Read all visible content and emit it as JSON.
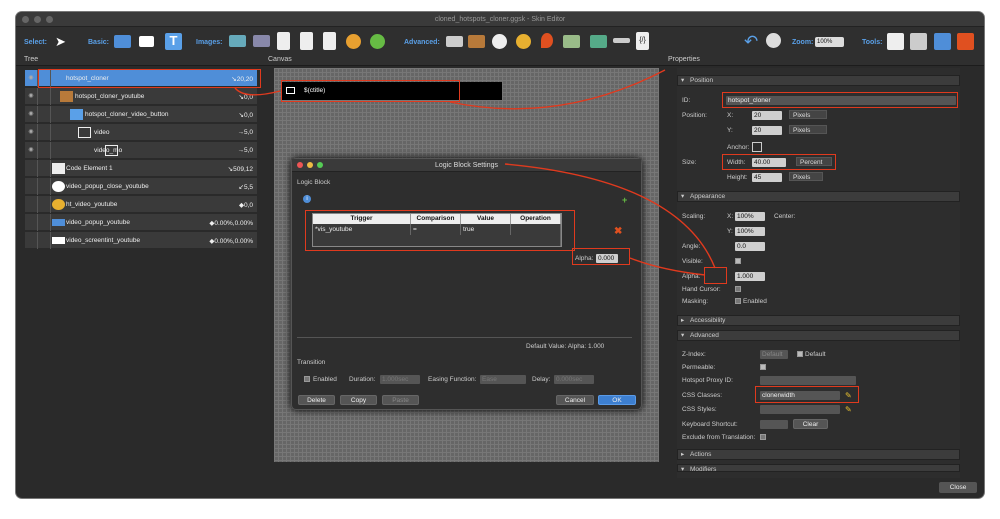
{
  "window": {
    "title": "cloned_hotspots_cloner.ggsk - Skin Editor"
  },
  "toolbar": {
    "select_label": "Select:",
    "basic_label": "Basic:",
    "images_label": "Images:",
    "advanced_label": "Advanced:",
    "zoom_label": "Zoom:",
    "zoom_value": "100%",
    "tools_label": "Tools:"
  },
  "sections": {
    "tree": "Tree",
    "canvas": "Canvas",
    "properties": "Properties"
  },
  "tree": [
    {
      "label": "hotspot_cloner",
      "pos": "↘20,20",
      "selected": true
    },
    {
      "label": "hotspot_cloner_youtube",
      "pos": "↘0,0"
    },
    {
      "label": "hotspot_cloner_video_button",
      "pos": "↘0,0"
    },
    {
      "label": "video",
      "pos": "→5,0"
    },
    {
      "label": "video_mo",
      "pos": "→5,0"
    },
    {
      "label": "Code Element 1",
      "pos": "↘509,12"
    },
    {
      "label": "video_popup_close_youtube",
      "pos": "↙5,5"
    },
    {
      "label": "ht_video_youtube",
      "pos": "◆0,0"
    },
    {
      "label": "video_popup_youtube",
      "pos": "◆0.00%,0.00%"
    },
    {
      "label": "video_screentint_youtube",
      "pos": "◆0.00%,0.00%"
    }
  ],
  "canvas": {
    "hotspot_text": "$(ctitle)"
  },
  "dialog": {
    "title": "Logic Block Settings",
    "section": "Logic Block",
    "headers": [
      "Trigger",
      "Comparison",
      "Value",
      "Operation"
    ],
    "row": [
      "*vis_youtube",
      "=",
      "true",
      ""
    ],
    "alpha_label": "Alpha:",
    "alpha_value": "0.000",
    "default_value": "Default Value:   Alpha: 1.000",
    "transition": "Transition",
    "enabled": "Enabled",
    "duration": "Duration:",
    "duration_val": "1.000sec",
    "easing": "Easing Function:",
    "easing_val": "Ease",
    "delay": "Delay:",
    "delay_val": "0.000sec",
    "btn_delete": "Delete",
    "btn_copy": "Copy",
    "btn_paste": "Paste",
    "btn_cancel": "Cancel",
    "btn_ok": "OK"
  },
  "properties": {
    "position_head": "Position",
    "id_label": "ID:",
    "id_value": "hotspot_cloner",
    "position_label": "Position:",
    "x_label": "X:",
    "x_value": "20",
    "y_label": "Y:",
    "y_value": "20",
    "unit_pixels": "Pixels",
    "anchor_label": "Anchor:",
    "size_label": "Size:",
    "width_label": "Width:",
    "width_value": "40.00",
    "width_unit": "Percent",
    "height_label": "Height:",
    "height_value": "45",
    "appearance_head": "Appearance",
    "scaling_label": "Scaling:",
    "scale_x": "100%",
    "center_label": "Center:",
    "scale_y": "100%",
    "angle_label": "Angle:",
    "angle_value": "0.0",
    "visible_label": "Visible:",
    "alpha_label": "Alpha:",
    "alpha_value": "1.000",
    "hand_label": "Hand Cursor:",
    "masking_label": "Masking:",
    "masking_enabled": "Enabled",
    "accessibility_head": "Accessibility",
    "advanced_head": "Advanced",
    "zindex_label": "Z-Index:",
    "zindex_value": "Default",
    "zindex_default": "Default",
    "permeable_label": "Permeable:",
    "proxy_label": "Hotspot Proxy ID:",
    "css_classes_label": "CSS Classes:",
    "css_classes_value": "clonerwidth",
    "css_styles_label": "CSS Styles:",
    "keyboard_label": "Keyboard Shortcut:",
    "clear_btn": "Clear",
    "exclude_label": "Exclude from Translation:",
    "actions_head": "Actions",
    "modifiers_head": "Modifiers"
  },
  "footer": {
    "close": "Close"
  },
  "colors": {
    "accent": "#4f8ed8",
    "annotation": "#e03a1e"
  }
}
